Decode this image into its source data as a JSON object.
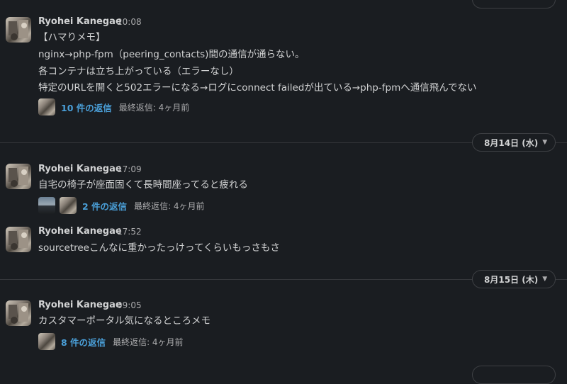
{
  "date_separators": [
    {
      "label": "8月14日 (水)"
    },
    {
      "label": "8月15日 (木)"
    }
  ],
  "messages": [
    {
      "author": "Ryohei Kanegae",
      "time": "20:08",
      "lines": [
        "【ハマりメモ】",
        "nginx→php-fpm（peering_contacts)間の通信が通らない。",
        "各コンテナは立ち上がっている（エラーなし）",
        "特定のURLを開くと502エラーになる→ログにconnect failedが出ている→php-fpmへ通信飛んでない"
      ],
      "thread": {
        "count": "10 件の返信",
        "last": "最終返信: 4ヶ月前"
      }
    },
    {
      "author": "Ryohei Kanegae",
      "time": "17:09",
      "lines": [
        "自宅の椅子が座面固くて長時間座ってると疲れる"
      ],
      "thread": {
        "count": "2 件の返信",
        "last": "最終返信: 4ヶ月前"
      }
    },
    {
      "author": "Ryohei Kanegae",
      "time": "17:52",
      "lines": [
        "sourcetreeこんなに重かったっけってくらいもっさもさ"
      ]
    },
    {
      "author": "Ryohei Kanegae",
      "time": "09:05",
      "lines": [
        "カスタマーポータル気になるところメモ"
      ],
      "thread": {
        "count": "8 件の返信",
        "last": "最終返信: 4ヶ月前"
      }
    }
  ],
  "icons": {
    "chevron": "chevron-down-icon"
  },
  "colors": {
    "background": "#1a1d21",
    "link": "#4a9fd8",
    "text": "#d1d2d3",
    "muted": "#ababad"
  }
}
